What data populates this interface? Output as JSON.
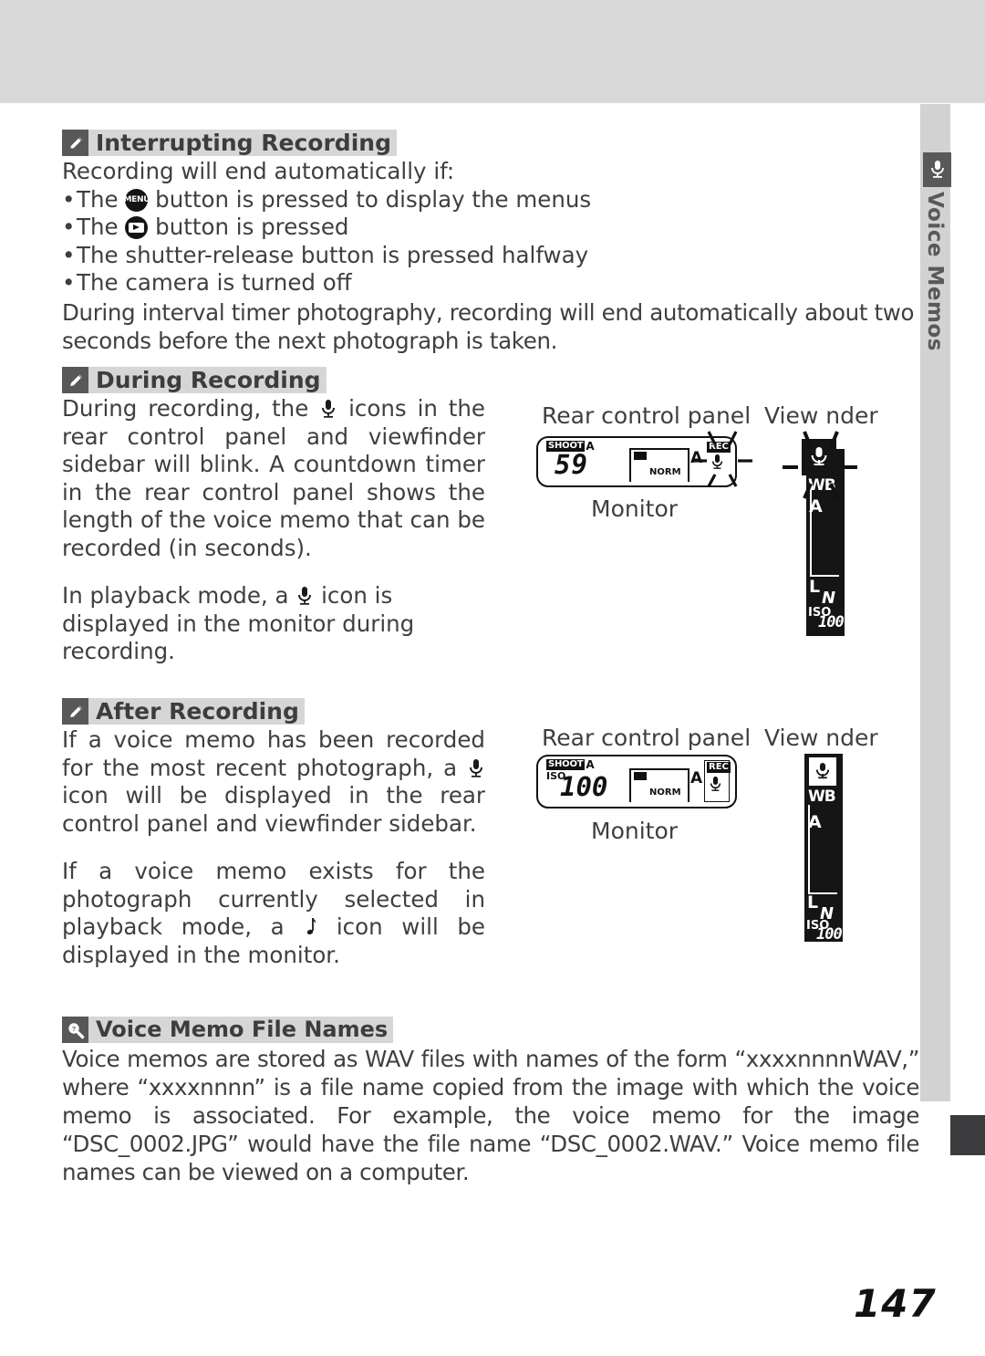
{
  "page": {
    "number": "147",
    "side_tab_label": "Voice Memos",
    "side_tab_icon": "microphone-icon"
  },
  "sections": [
    {
      "id": "interrupting",
      "icon": "pencil-note-icon",
      "title": "Interrupting Recording",
      "intro": "Recording will end automatically if:",
      "bullets": [
        {
          "pre": "The",
          "glyph": "menu-button-icon",
          "post": "button is pressed to display the menus"
        },
        {
          "pre": "The",
          "glyph": "playback-button-icon",
          "post": "button is pressed"
        },
        {
          "pre": "",
          "glyph": "",
          "post": "The shutter-release button is pressed halfway"
        },
        {
          "pre": "",
          "glyph": "",
          "post": "The camera is turned off"
        }
      ],
      "paragraph": "During interval timer photography, recording will end automatically about two seconds before the next photograph is taken."
    },
    {
      "id": "during",
      "icon": "pencil-note-icon",
      "title": "During Recording",
      "para1_a": "During recording, the",
      "para1_glyph": "microphone-icon",
      "para1_b": "icons in the rear control panel and viewfinder sidebar will blink.  A countdown timer in the rear control panel shows the length of the voice memo that can be recorded (in seconds).",
      "para2_a": "In playback mode, a",
      "para2_glyph": "microphone-icon",
      "para2_b": "icon is displayed in the monitor during recording."
    },
    {
      "id": "after",
      "icon": "pencil-note-icon",
      "title": "After Recording",
      "para1_a": "If a voice memo has been recorded for the most recent photograph, a",
      "para1_glyph": "microphone-icon",
      "para1_b": "icon will be displayed in the rear control panel and viewfinder sidebar.",
      "para2_a": "If a voice memo exists for the photograph currently selected in playback mode, a",
      "para2_glyph": "music-note-icon",
      "para2_b": "icon will be displayed in the monitor."
    },
    {
      "id": "filenames",
      "icon": "magnifier-tip-icon",
      "title": "Voice Memo File Names",
      "paragraph": "Voice memos are stored as WAV files with names of the form “xxxxnnnnWAV,” where “xxxxnnnn” is a file name copied from the image with which the voice memo is associated.  For example, the voice memo for the image “DSC_0002.JPG” would have the file name “DSC_0002.WAV.”  Voice memo file names can be viewed on a computer."
    }
  ],
  "figures": [
    {
      "id": "figure-during-recording",
      "label_panel": "Rear control panel",
      "label_viewfinder": "View  nder",
      "label_monitor": "Monitor",
      "lcd": {
        "shoot_badge": "SHOOT",
        "mode_letter": "A",
        "iso_label": "",
        "counter_value": "59",
        "frame_quality": "NORM",
        "frame_letter": "A",
        "rec_badge": "REC",
        "mic_icon": "microphone-icon",
        "blinking": true
      },
      "viewfinder": {
        "mic_icon": "microphone-icon",
        "mic_highlighted": true,
        "blinking": true,
        "wb_label": "WB",
        "wb_value": "A",
        "size_label": "L",
        "quality_label": "N",
        "iso_label": "ISO",
        "iso_value": "100"
      }
    },
    {
      "id": "figure-after-recording",
      "label_panel": "Rear control panel",
      "label_viewfinder": "View  nder",
      "label_monitor": "Monitor",
      "lcd": {
        "shoot_badge": "SHOOT",
        "mode_letter": "A",
        "iso_label": "ISO",
        "counter_value": "100",
        "frame_quality": "NORM",
        "frame_letter": "A",
        "rec_badge": "REC",
        "mic_icon": "microphone-icon",
        "blinking": false
      },
      "viewfinder": {
        "mic_icon": "microphone-icon",
        "mic_highlighted": true,
        "blinking": false,
        "wb_label": "WB",
        "wb_value": "A",
        "size_label": "L",
        "quality_label": "N",
        "iso_label": "ISO",
        "iso_value": "100"
      }
    }
  ],
  "colors": {
    "header_band": "#d9d9d9",
    "side_strip": "#d2d2d2",
    "icon_box": "#58585a",
    "title_highlight": "#d6d6d6",
    "body_text": "#3f3f41",
    "lcd_ink": "#111111",
    "viewfinder_bg": "#151515"
  }
}
